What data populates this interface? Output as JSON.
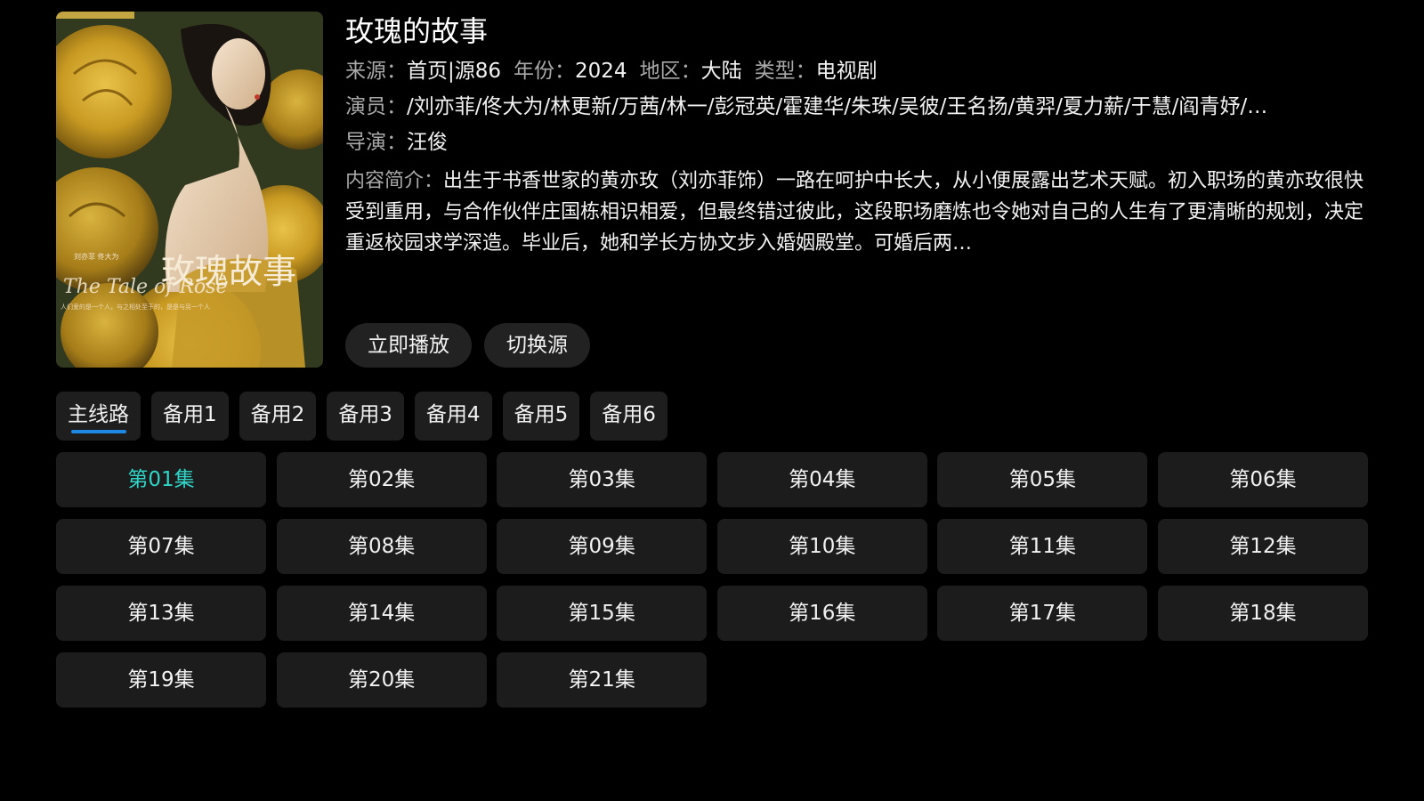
{
  "detail": {
    "title": "玫瑰的故事",
    "source_label": "来源：",
    "source_value": "首页|源86",
    "year_label": "年份：",
    "year_value": "2024",
    "region_label": "地区：",
    "region_value": "大陆",
    "type_label": "类型：",
    "type_value": "电视剧",
    "cast_label": "演员：",
    "cast_value": "/刘亦菲/佟大为/林更新/万茜/林一/彭冠英/霍建华/朱珠/吴彼/王名扬/黄羿/夏力薪/于慧/阎青妤/…",
    "director_label": "导演：",
    "director_value": "汪俊",
    "summary_label": "内容简介：",
    "summary_value": "出生于书香世家的黄亦玫（刘亦菲饰）一路在呵护中长大，从小便展露出艺术天赋。初入职场的黄亦玫很快受到重用，与合作伙伴庄国栋相识相爱，但最终错过彼此，这段职场磨炼也令她对自己的人生有了更清晰的规划，决定重返校园求学深造。毕业后，她和学长方协文步入婚姻殿堂。可婚后两…"
  },
  "poster": {
    "calligraphy_title": "玫瑰故事",
    "script_text": "The Tale of Rose",
    "credits_text": "刘亦菲  佟大为",
    "tagline_text": "人们爱的是一个人，与之相处至于的，是是与另一个人"
  },
  "actions": {
    "play_label": "立即播放",
    "switch_source_label": "切换源"
  },
  "sources": {
    "active_index": 0,
    "items": [
      "主线路",
      "备用1",
      "备用2",
      "备用3",
      "备用4",
      "备用5",
      "备用6"
    ]
  },
  "episodes": {
    "active_index": 0,
    "items": [
      "第01集",
      "第02集",
      "第03集",
      "第04集",
      "第05集",
      "第06集",
      "第07集",
      "第08集",
      "第09集",
      "第10集",
      "第11集",
      "第12集",
      "第13集",
      "第14集",
      "第15集",
      "第16集",
      "第17集",
      "第18集",
      "第19集",
      "第20集",
      "第21集"
    ]
  },
  "colors": {
    "accent_active_episode": "#30d5c8",
    "source_underline": "#1e88e5",
    "background": "#000000"
  }
}
